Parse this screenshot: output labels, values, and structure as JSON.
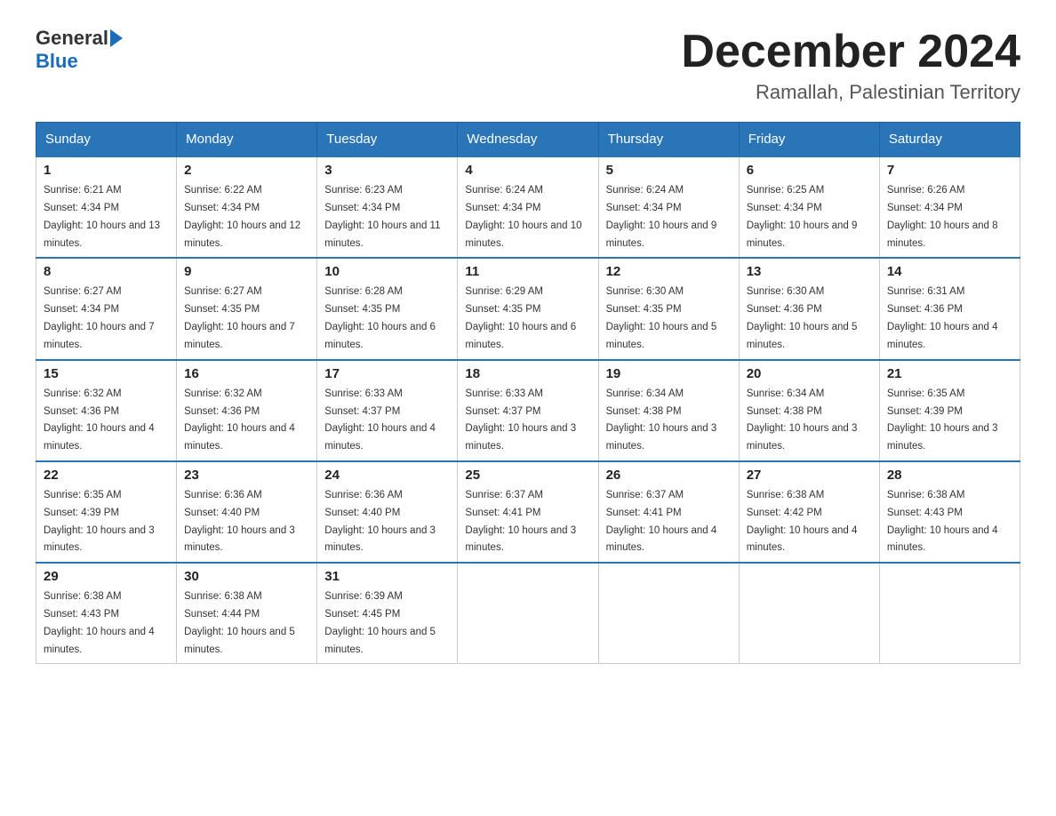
{
  "header": {
    "logo_general": "General",
    "logo_blue": "Blue",
    "month": "December 2024",
    "location": "Ramallah, Palestinian Territory"
  },
  "days_of_week": [
    "Sunday",
    "Monday",
    "Tuesday",
    "Wednesday",
    "Thursday",
    "Friday",
    "Saturday"
  ],
  "weeks": [
    [
      {
        "day": "1",
        "sunrise": "6:21 AM",
        "sunset": "4:34 PM",
        "daylight": "10 hours and 13 minutes."
      },
      {
        "day": "2",
        "sunrise": "6:22 AM",
        "sunset": "4:34 PM",
        "daylight": "10 hours and 12 minutes."
      },
      {
        "day": "3",
        "sunrise": "6:23 AM",
        "sunset": "4:34 PM",
        "daylight": "10 hours and 11 minutes."
      },
      {
        "day": "4",
        "sunrise": "6:24 AM",
        "sunset": "4:34 PM",
        "daylight": "10 hours and 10 minutes."
      },
      {
        "day": "5",
        "sunrise": "6:24 AM",
        "sunset": "4:34 PM",
        "daylight": "10 hours and 9 minutes."
      },
      {
        "day": "6",
        "sunrise": "6:25 AM",
        "sunset": "4:34 PM",
        "daylight": "10 hours and 9 minutes."
      },
      {
        "day": "7",
        "sunrise": "6:26 AM",
        "sunset": "4:34 PM",
        "daylight": "10 hours and 8 minutes."
      }
    ],
    [
      {
        "day": "8",
        "sunrise": "6:27 AM",
        "sunset": "4:34 PM",
        "daylight": "10 hours and 7 minutes."
      },
      {
        "day": "9",
        "sunrise": "6:27 AM",
        "sunset": "4:35 PM",
        "daylight": "10 hours and 7 minutes."
      },
      {
        "day": "10",
        "sunrise": "6:28 AM",
        "sunset": "4:35 PM",
        "daylight": "10 hours and 6 minutes."
      },
      {
        "day": "11",
        "sunrise": "6:29 AM",
        "sunset": "4:35 PM",
        "daylight": "10 hours and 6 minutes."
      },
      {
        "day": "12",
        "sunrise": "6:30 AM",
        "sunset": "4:35 PM",
        "daylight": "10 hours and 5 minutes."
      },
      {
        "day": "13",
        "sunrise": "6:30 AM",
        "sunset": "4:36 PM",
        "daylight": "10 hours and 5 minutes."
      },
      {
        "day": "14",
        "sunrise": "6:31 AM",
        "sunset": "4:36 PM",
        "daylight": "10 hours and 4 minutes."
      }
    ],
    [
      {
        "day": "15",
        "sunrise": "6:32 AM",
        "sunset": "4:36 PM",
        "daylight": "10 hours and 4 minutes."
      },
      {
        "day": "16",
        "sunrise": "6:32 AM",
        "sunset": "4:36 PM",
        "daylight": "10 hours and 4 minutes."
      },
      {
        "day": "17",
        "sunrise": "6:33 AM",
        "sunset": "4:37 PM",
        "daylight": "10 hours and 4 minutes."
      },
      {
        "day": "18",
        "sunrise": "6:33 AM",
        "sunset": "4:37 PM",
        "daylight": "10 hours and 3 minutes."
      },
      {
        "day": "19",
        "sunrise": "6:34 AM",
        "sunset": "4:38 PM",
        "daylight": "10 hours and 3 minutes."
      },
      {
        "day": "20",
        "sunrise": "6:34 AM",
        "sunset": "4:38 PM",
        "daylight": "10 hours and 3 minutes."
      },
      {
        "day": "21",
        "sunrise": "6:35 AM",
        "sunset": "4:39 PM",
        "daylight": "10 hours and 3 minutes."
      }
    ],
    [
      {
        "day": "22",
        "sunrise": "6:35 AM",
        "sunset": "4:39 PM",
        "daylight": "10 hours and 3 minutes."
      },
      {
        "day": "23",
        "sunrise": "6:36 AM",
        "sunset": "4:40 PM",
        "daylight": "10 hours and 3 minutes."
      },
      {
        "day": "24",
        "sunrise": "6:36 AM",
        "sunset": "4:40 PM",
        "daylight": "10 hours and 3 minutes."
      },
      {
        "day": "25",
        "sunrise": "6:37 AM",
        "sunset": "4:41 PM",
        "daylight": "10 hours and 3 minutes."
      },
      {
        "day": "26",
        "sunrise": "6:37 AM",
        "sunset": "4:41 PM",
        "daylight": "10 hours and 4 minutes."
      },
      {
        "day": "27",
        "sunrise": "6:38 AM",
        "sunset": "4:42 PM",
        "daylight": "10 hours and 4 minutes."
      },
      {
        "day": "28",
        "sunrise": "6:38 AM",
        "sunset": "4:43 PM",
        "daylight": "10 hours and 4 minutes."
      }
    ],
    [
      {
        "day": "29",
        "sunrise": "6:38 AM",
        "sunset": "4:43 PM",
        "daylight": "10 hours and 4 minutes."
      },
      {
        "day": "30",
        "sunrise": "6:38 AM",
        "sunset": "4:44 PM",
        "daylight": "10 hours and 5 minutes."
      },
      {
        "day": "31",
        "sunrise": "6:39 AM",
        "sunset": "4:45 PM",
        "daylight": "10 hours and 5 minutes."
      },
      null,
      null,
      null,
      null
    ]
  ]
}
